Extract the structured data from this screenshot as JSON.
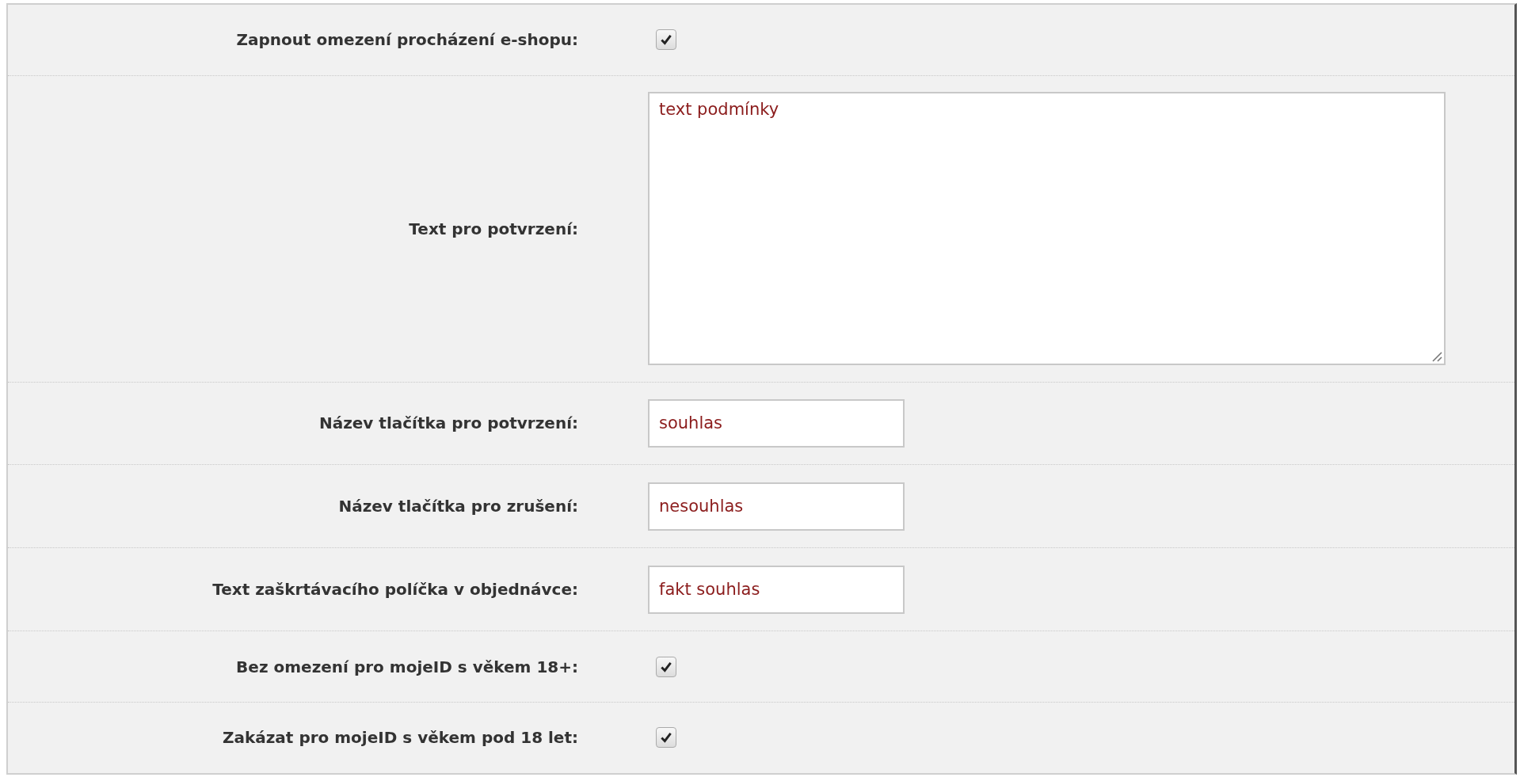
{
  "fields": [
    {
      "kind": "checkbox",
      "label": "Zapnout omezení procházení e-shopu:",
      "checked": true
    },
    {
      "kind": "textarea",
      "label": "Text pro potvrzení:",
      "value": "text podmínky"
    },
    {
      "kind": "text",
      "label": "Název tlačítka pro potvrzení:",
      "value": "souhlas"
    },
    {
      "kind": "text",
      "label": "Název tlačítka pro zrušení:",
      "value": "nesouhlas"
    },
    {
      "kind": "text",
      "label": "Text zaškrtávacího políčka v objednávce:",
      "value": "fakt souhlas"
    },
    {
      "kind": "checkbox",
      "label": "Bez omezení pro mojeID s věkem 18+:",
      "checked": true
    },
    {
      "kind": "checkbox",
      "label": "Zakázat pro mojeID s věkem pod 18 let:",
      "checked": true
    }
  ]
}
